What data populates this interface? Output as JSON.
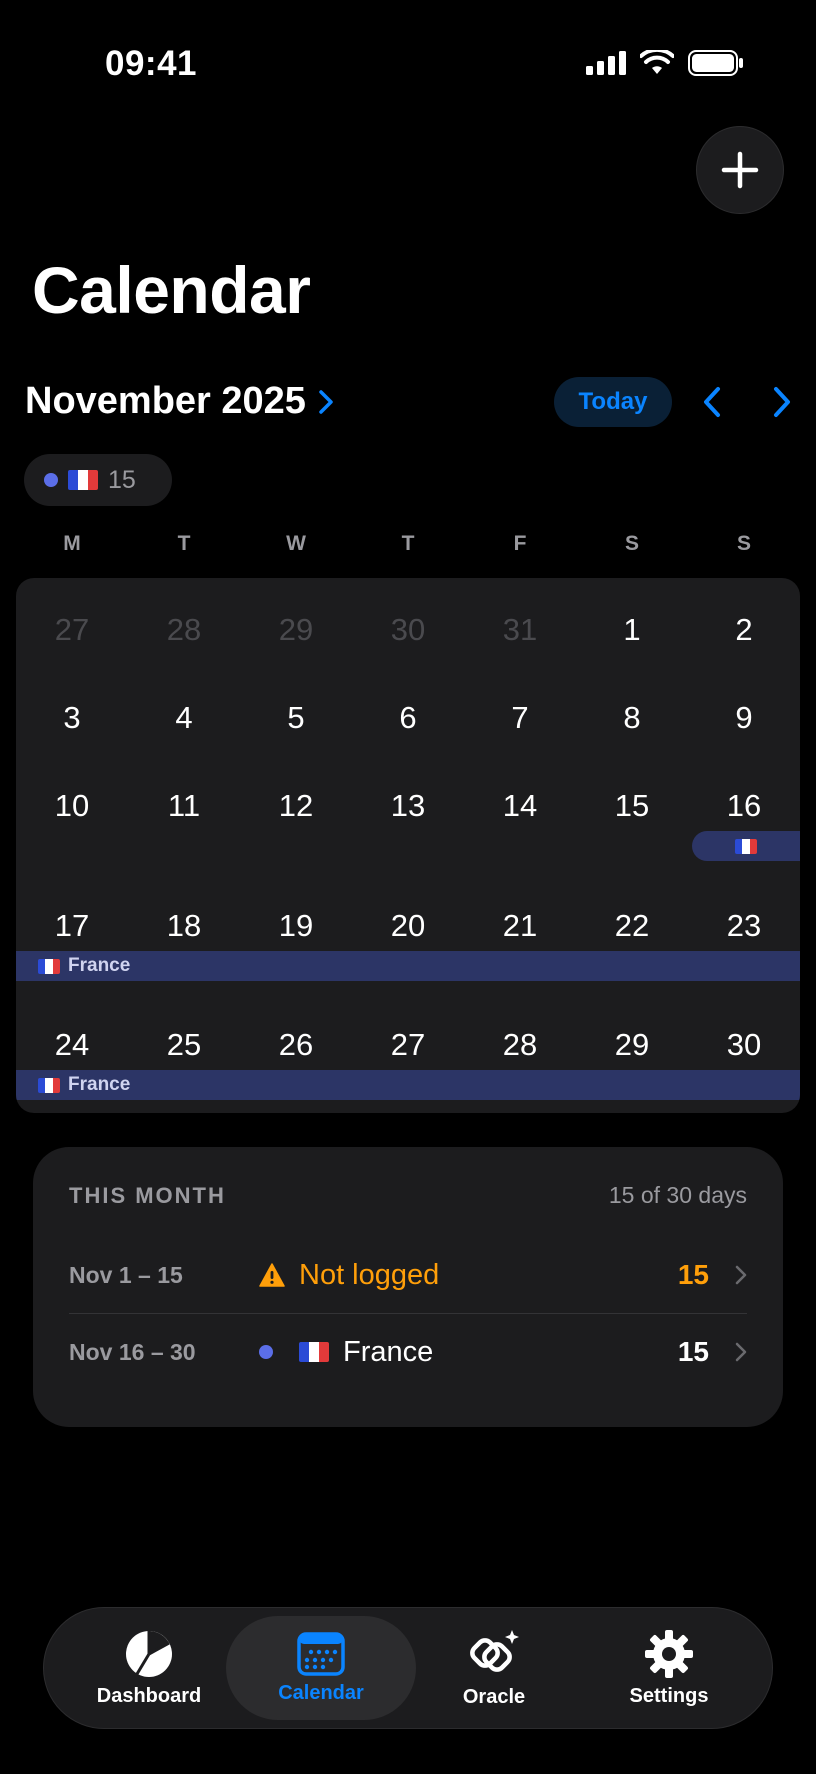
{
  "status": {
    "time": "09:41"
  },
  "page_title": "Calendar",
  "month": {
    "title": "November 2025",
    "today_label": "Today"
  },
  "summary_chip": {
    "count": "15",
    "dot_color": "#5b6ee8"
  },
  "weekdays": [
    "M",
    "T",
    "W",
    "T",
    "F",
    "S",
    "S"
  ],
  "calendar": {
    "weeks": [
      [
        "27",
        "28",
        "29",
        "30",
        "31",
        "1",
        "2"
      ],
      [
        "3",
        "4",
        "5",
        "6",
        "7",
        "8",
        "9"
      ],
      [
        "10",
        "11",
        "12",
        "13",
        "14",
        "15",
        "16"
      ],
      [
        "17",
        "18",
        "19",
        "20",
        "21",
        "22",
        "23"
      ],
      [
        "24",
        "25",
        "26",
        "27",
        "28",
        "29",
        "30"
      ]
    ],
    "band_label": "France"
  },
  "this_month": {
    "title": "THIS MONTH",
    "count": "15 of 30 days",
    "rows": [
      {
        "range": "Nov 1 – 15",
        "label": "Not logged",
        "count": "15",
        "color": "#ff9f0a"
      },
      {
        "range": "Nov 16 – 30",
        "label": "France",
        "count": "15",
        "color": "#ffffff"
      }
    ]
  },
  "tabs": [
    {
      "label": "Dashboard"
    },
    {
      "label": "Calendar"
    },
    {
      "label": "Oracle"
    },
    {
      "label": "Settings"
    }
  ],
  "colors": {
    "accent": "#0a84ff",
    "warning": "#ff9f0a",
    "band": "#2c3566",
    "country_dot": "#5b6ee8"
  }
}
